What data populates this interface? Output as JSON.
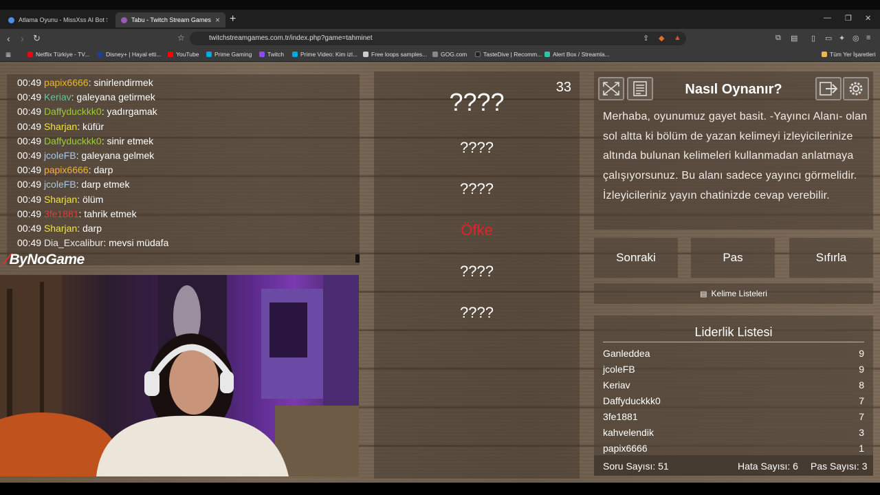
{
  "browser": {
    "tabs": [
      {
        "title": "Atlama Oyunu - MissXss AI Bot Syste...",
        "color": "#4a90e2"
      },
      {
        "title": "Tabu - Twitch Stream Games",
        "color": "#9b59b6"
      }
    ],
    "url": "twitchstreamgames.com.tr/index.php?game=tahminet",
    "bookmarks": [
      {
        "label": "Netflix Türkiye - TV...",
        "color": "#e50914"
      },
      {
        "label": "Disney+ | Hayal etti...",
        "color": "#1c3f94"
      },
      {
        "label": "YouTube",
        "color": "#ff0000"
      },
      {
        "label": "Prime Gaming",
        "color": "#00a8e1"
      },
      {
        "label": "Twitch",
        "color": "#9146ff"
      },
      {
        "label": "Prime Video: Kim izl...",
        "color": "#00a8e1"
      },
      {
        "label": "Free loops samples...",
        "color": "#cccccc"
      },
      {
        "label": "GOG.com",
        "color": "#888888"
      },
      {
        "label": "TasteDive | Recomm...",
        "color": "#222222"
      },
      {
        "label": "Alert Box / Streamla...",
        "color": "#31c3a2"
      }
    ],
    "all_bookmarks": "Tüm Yer İşaretleri"
  },
  "chat": {
    "messages": [
      {
        "time": "00:49",
        "user": "papix6666",
        "color": "#f2b134",
        "text": "sinirlendirmek"
      },
      {
        "time": "00:49",
        "user": "Keriav",
        "color": "#64c8a0",
        "text": "galeyana getirmek"
      },
      {
        "time": "00:49",
        "user": "Daffyduckkk0",
        "color": "#9acd32",
        "text": "yadırgamak"
      },
      {
        "time": "00:49",
        "user": "Sharjan",
        "color": "#f4e04d",
        "text": "küfür"
      },
      {
        "time": "00:49",
        "user": "Daffyduckkk0",
        "color": "#9acd32",
        "text": "sinir etmek"
      },
      {
        "time": "00:49",
        "user": "jcoleFB",
        "color": "#a8c8e8",
        "text": "galeyana gelmek"
      },
      {
        "time": "00:49",
        "user": "papix6666",
        "color": "#f2b134",
        "text": "darp"
      },
      {
        "time": "00:49",
        "user": "jcoleFB",
        "color": "#a8c8e8",
        "text": "darp etmek"
      },
      {
        "time": "00:49",
        "user": "Sharjan",
        "color": "#f4e04d",
        "text": "ölüm"
      },
      {
        "time": "00:49",
        "user": "3fe1881",
        "color": "#e03c3c",
        "text": "tahrik etmek"
      },
      {
        "time": "00:49",
        "user": "Sharjan",
        "color": "#f4e04d",
        "text": "darp"
      },
      {
        "time": "00:49",
        "user": "Dia_Excalibur",
        "color": "#e8e8e8",
        "text": "mevsi müdafa"
      }
    ]
  },
  "brand": "ByNoGame",
  "game": {
    "counter": "33",
    "words": [
      "????",
      "????",
      "????",
      "Öfke",
      "????",
      "????"
    ]
  },
  "help": {
    "title": "Nasıl Oynanır?",
    "text": "Merhaba, oyunumuz gayet basit. -Yayıncı Alanı- olan sol altta ki bölüm de yazan kelimeyi izleyicilerinize altında bulunan kelimeleri kullanmadan anlatmaya çalışıyorsunuz. Bu alanı sadece yayıncı görmelidir. İzleyicileriniz yayın chatinizde cevap verebilir."
  },
  "actions": {
    "next": "Sonraki",
    "pass": "Pas",
    "reset": "Sıfırla",
    "word_lists": "Kelime Listeleri"
  },
  "leaderboard": {
    "title": "Liderlik Listesi",
    "rows": [
      {
        "name": "Ganleddea",
        "score": "9"
      },
      {
        "name": "jcoleFB",
        "score": "9"
      },
      {
        "name": "Keriav",
        "score": "8"
      },
      {
        "name": "Daffyduckkk0",
        "score": "7"
      },
      {
        "name": "3fe1881",
        "score": "7"
      },
      {
        "name": "kahvelendik",
        "score": "3"
      },
      {
        "name": "papix6666",
        "score": "1"
      }
    ]
  },
  "stats": {
    "questions": "Soru Sayısı: 51",
    "errors": "Hata Sayısı: 6",
    "passes": "Pas Sayısı: 3"
  }
}
